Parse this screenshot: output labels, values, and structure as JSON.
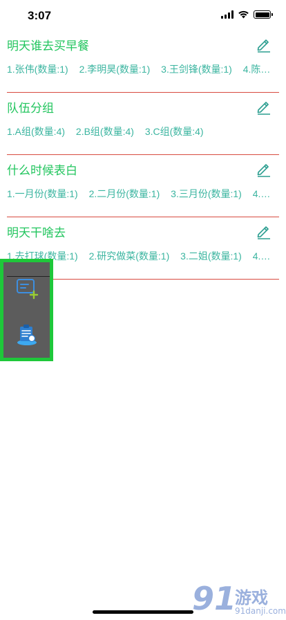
{
  "status_bar": {
    "time": "3:07"
  },
  "groups": [
    {
      "title": "明天谁去买早餐",
      "items": [
        "1.张伟(数量:1)",
        "2.李明昊(数量:1)",
        "3.王剑锋(数量:1)",
        "4.陈…"
      ]
    },
    {
      "title": "队伍分组",
      "items": [
        "1.A组(数量:4)",
        "2.B组(数量:4)",
        "3.C组(数量:4)"
      ]
    },
    {
      "title": "什么时候表白",
      "items": [
        "1.一月份(数量:1)",
        "2.二月份(数量:1)",
        "3.三月份(数量:1)",
        "4.…"
      ]
    },
    {
      "title": "明天干啥去",
      "items": [
        "1.去打球(数量:1)",
        "2.研究做菜(数量:1)",
        "3.二姐(数量:1)",
        "4.…"
      ]
    }
  ],
  "floating_menu": {
    "icons": [
      "add-note-icon",
      "clipboard-list-icon"
    ]
  },
  "watermark": {
    "logo": "91",
    "text": "游戏",
    "url": "91danji.com"
  },
  "colors": {
    "title": "#22c55e",
    "items": "#3bb5a0",
    "divider": "#d84a3f",
    "menu_border": "#1ec83a",
    "menu_bg": "#5c5c5c"
  }
}
